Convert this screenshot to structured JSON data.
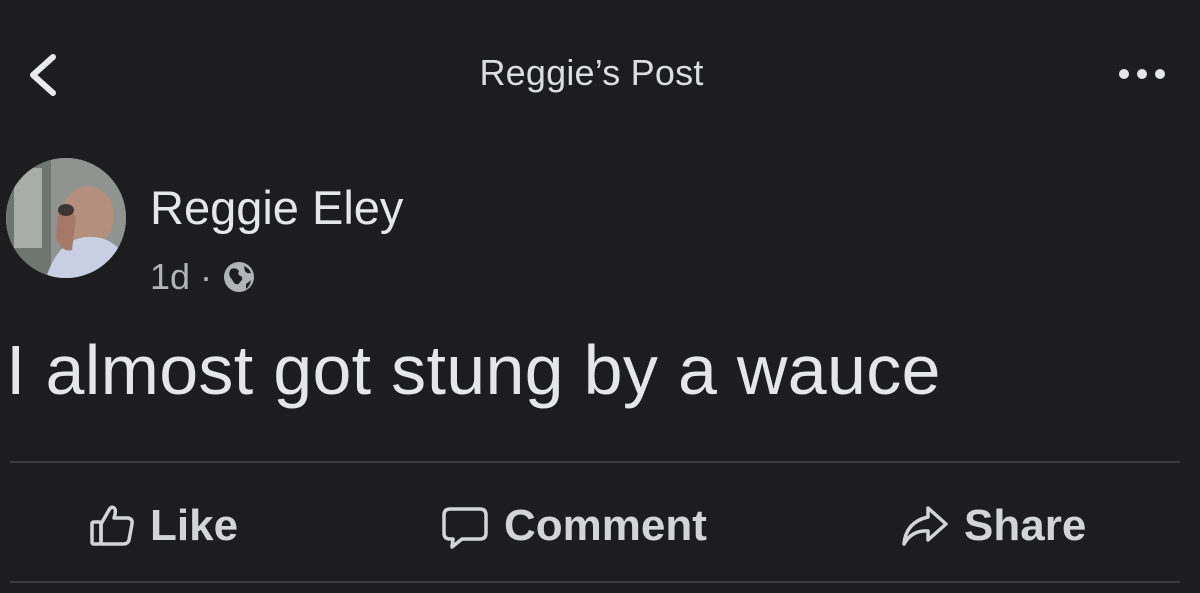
{
  "header": {
    "title": "Reggie’s Post",
    "back_icon": "chevron-left-icon",
    "more_icon": "more-horizontal-icon"
  },
  "post": {
    "author": "Reggie Eley",
    "time": "1d",
    "separator": "·",
    "privacy_icon": "globe-icon",
    "text": "I almost got stung by a wauce"
  },
  "actions": {
    "like_label": "Like",
    "comment_label": "Comment",
    "share_label": "Share"
  },
  "colors": {
    "background": "#1d1d20",
    "text": "#e4e6ea",
    "secondary_text": "#b0b3b8",
    "divider": "#3a3b3e"
  }
}
